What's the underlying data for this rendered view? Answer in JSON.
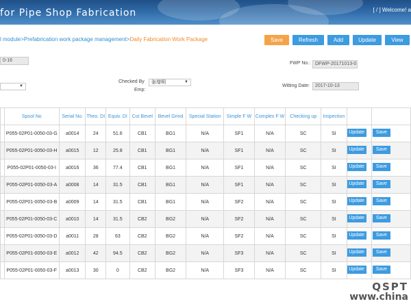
{
  "header": {
    "title": "for Pipe Shop Fabrication",
    "right_prefix": "[ ",
    "link1": "",
    "slash": " / ",
    "link2": "",
    "right_suffix": " ] Welcome! a"
  },
  "breadcrumb": {
    "part1": "l module",
    "sep1": ">",
    "part2": "Prefabrication work package management",
    "sep2": ">",
    "current": "Daily Fabrication Work Package"
  },
  "toolbar": {
    "save": "Save",
    "refresh": "Refresh",
    "add": "Add",
    "update": "Update",
    "view": "View"
  },
  "form": {
    "date_value": "0-16",
    "fwp_label": "FWP No.:",
    "fwp_value": "DFWP-20171013-0",
    "checked_by_label": "Checked By",
    "emp_label": "Emp:",
    "checked_by_value": "张增明",
    "writing_date_label": "Witting Date:",
    "writing_date_value": "2017-10-13"
  },
  "table": {
    "headers": [
      "",
      "Spool No",
      "Serial No.",
      "Theo. DI",
      "Equiv. DI",
      "Cut Bevel",
      "Bevel Grind",
      "Special Station",
      "Simple F W",
      "Complex F W",
      "Checking up",
      "Inspection",
      "",
      ""
    ],
    "update_label": "Update",
    "save_label": "Save",
    "rows": [
      [
        "P055-02P01-0050-03-G",
        "a0014",
        "24",
        "51.6",
        "CB1",
        "BG1",
        "N/A",
        "SF1",
        "N/A",
        "SC",
        "SI"
      ],
      [
        "P055-02P01-0050-03-H",
        "a0015",
        "12",
        "25.8",
        "CB1",
        "BG1",
        "N/A",
        "SF1",
        "N/A",
        "SC",
        "SI"
      ],
      [
        "P055-02P01-0050-03-I",
        "a0016",
        "36",
        "77.4",
        "CB1",
        "BG1",
        "N/A",
        "SF1",
        "N/A",
        "SC",
        "SI"
      ],
      [
        "P055-02P01-0050-03-A",
        "a0008",
        "14",
        "31.5",
        "CB1",
        "BG1",
        "N/A",
        "SF1",
        "N/A",
        "SC",
        "SI"
      ],
      [
        "P055-02P01-0050-03-B",
        "a0009",
        "14",
        "31.5",
        "CB1",
        "BG1",
        "N/A",
        "SF2",
        "N/A",
        "SC",
        "SI"
      ],
      [
        "P055-02P01-0050-03-C",
        "a0010",
        "14",
        "31.5",
        "CB2",
        "BG2",
        "N/A",
        "SF2",
        "N/A",
        "SC",
        "SI"
      ],
      [
        "P055-02P01-0050-03-D",
        "a0011",
        "28",
        "63",
        "CB2",
        "BG2",
        "N/A",
        "SF2",
        "N/A",
        "SC",
        "SI"
      ],
      [
        "P055-02P01-0050-03-E",
        "a0012",
        "42",
        "94.5",
        "CB2",
        "BG2",
        "N/A",
        "SF3",
        "N/A",
        "SC",
        "SI"
      ],
      [
        "P055-02P01-0050-03-F",
        "a0013",
        "30",
        "0",
        "CB2",
        "BG2",
        "N/A",
        "SF3",
        "N/A",
        "SC",
        "SI"
      ]
    ]
  },
  "watermark": {
    "logo": "QSPT",
    "url": "www.china"
  },
  "colors": {
    "accent_blue": "#3d9be0",
    "accent_orange": "#f5a349",
    "header_text": "#3b93d5",
    "breadcrumb_current": "#f08a2c"
  }
}
